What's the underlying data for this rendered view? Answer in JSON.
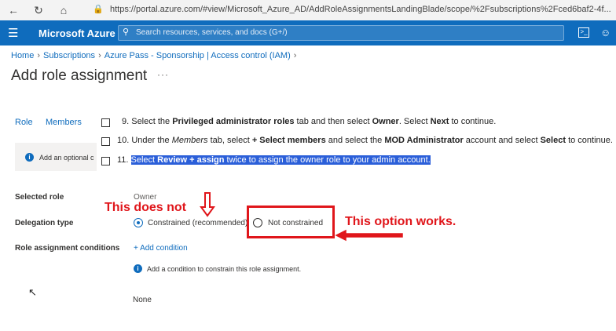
{
  "browser": {
    "url": "https://portal.azure.com/#view/Microsoft_Azure_AD/AddRoleAssignmentsLandingBlade/scope/%2Fsubscriptions%2Fced6baf2-4f...",
    "back_icon": "arrow-left-icon",
    "refresh_icon": "refresh-icon",
    "home_icon": "home-icon"
  },
  "header": {
    "brand": "Microsoft Azure",
    "search_placeholder": "Search resources, services, and docs (G+/)",
    "color": "#0f6cbd"
  },
  "breadcrumb": {
    "items": [
      "Home",
      "Subscriptions",
      "Azure Pass - Sponsorship | Access control (IAM)"
    ]
  },
  "page": {
    "title": "Add role assignment",
    "more": "..."
  },
  "tabs": [
    "Role",
    "Members"
  ],
  "info_banner": {
    "text": "Add an optional c"
  },
  "steps": [
    {
      "parts": [
        "9. Select the ",
        "Privileged administrator roles",
        " tab and then select ",
        "Owner",
        ". Select ",
        "Next",
        " to continue."
      ]
    },
    {
      "parts": [
        "10. Under the ",
        "Members",
        " tab, select ",
        "+ Select members",
        " and select the ",
        "MOD Administrator",
        " account and select ",
        "Select",
        " to continue."
      ]
    },
    {
      "parts": [
        "11. ",
        "Select ",
        "Review + assign",
        " twice to assign the owner role to your admin account."
      ]
    }
  ],
  "form": {
    "selected_role_label": "Selected role",
    "selected_role_value": "Owner",
    "delegation_label": "Delegation type",
    "option_constrained": "Constrained (recommended)",
    "option_not_constrained": "Not constrained",
    "conditions_label": "Role assignment conditions",
    "add_condition": "+ Add condition",
    "condition_info": "Add a condition to constrain this role assignment.",
    "none": "None"
  },
  "annotations": {
    "left": "This does not",
    "right": "This option works.",
    "color": "#e0161b"
  }
}
